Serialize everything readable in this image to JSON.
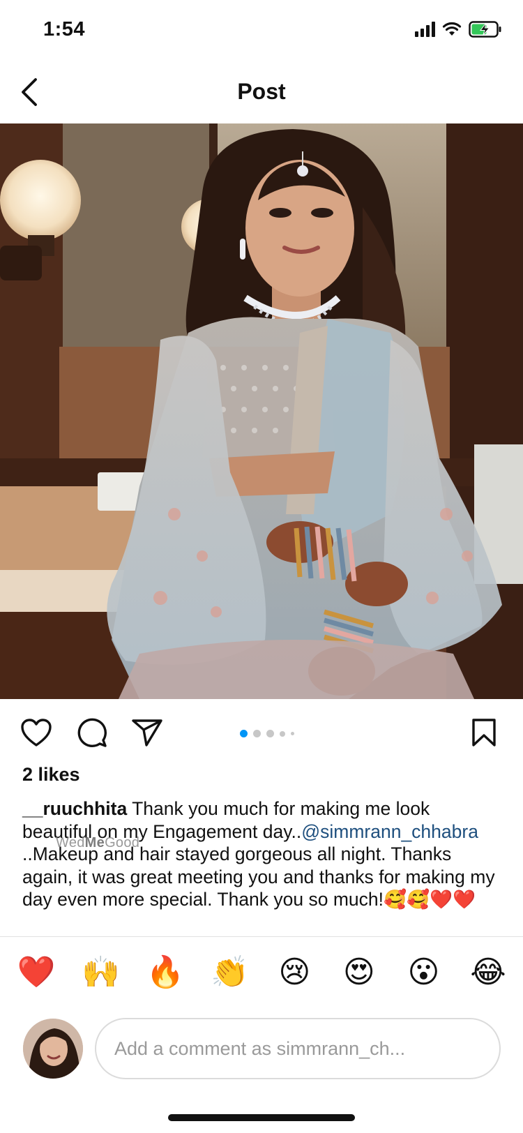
{
  "status_bar": {
    "time": "1:54"
  },
  "nav": {
    "title": "Post"
  },
  "photo": {
    "description_icon": "photo"
  },
  "actions": {
    "like_icon": "heart-icon",
    "comment_icon": "comment-icon",
    "share_icon": "send-icon",
    "save_icon": "bookmark-icon",
    "carousel_dots": 5,
    "active_dot": 0,
    "accent_color": "#0095f6"
  },
  "likes": "2 likes",
  "caption": {
    "username": "__ruuchhita",
    "text_before_mention": " Thank you  much for making me look beautiful on my Engagement day..",
    "mention": "@simmrann_chhabra",
    "text_after_mention": " ..Makeup and hair stayed gorgeous all night. Thanks again, it was great meeting you and thanks for making my day even more special. Thank you so much!🥰🥰❤️❤️"
  },
  "watermark": {
    "prefix": "Wed",
    "bold": "Me",
    "suffix": "Good"
  },
  "quick_reactions": [
    "❤️",
    "🙌",
    "🔥",
    "👏",
    "😢",
    "😍",
    "😮",
    "😂"
  ],
  "comment": {
    "placeholder": "Add a comment as simmrann_ch..."
  }
}
